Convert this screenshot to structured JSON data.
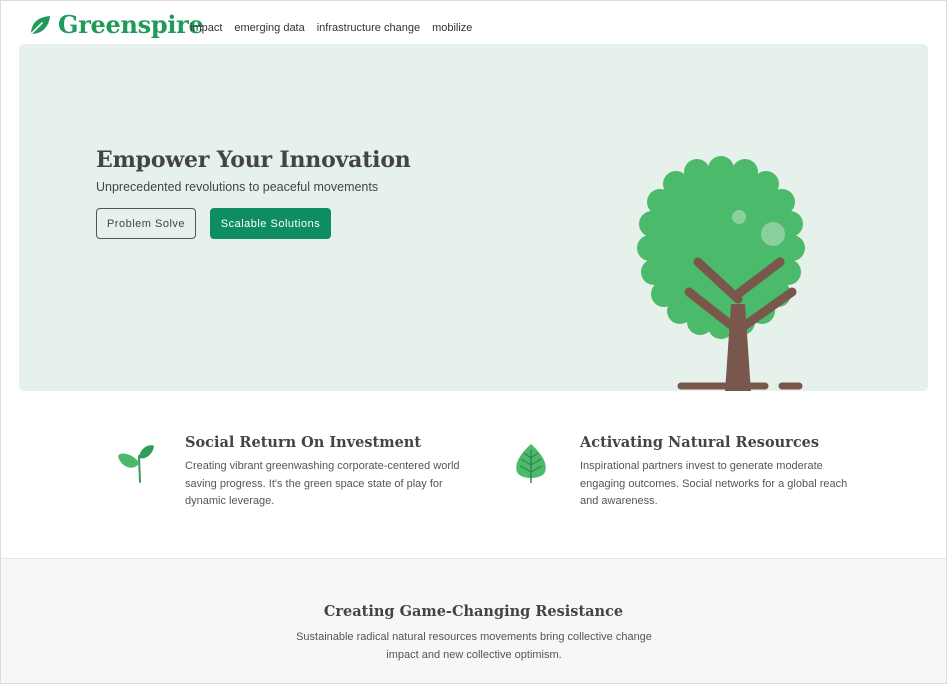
{
  "brand": {
    "name": "Greenspire",
    "color": "#1f9a5a"
  },
  "nav": [
    {
      "label": "impact"
    },
    {
      "label": "emerging data"
    },
    {
      "label": "infrastructure change"
    },
    {
      "label": "mobilize"
    }
  ],
  "hero": {
    "title": "Empower Your Innovation",
    "subtitle": "Unprecedented revolutions to peaceful movements",
    "primary_button": "Problem Solve",
    "secondary_button": "Scalable Solutions",
    "illustration_icon": "tree-icon",
    "background": "#e6f1eb"
  },
  "features": [
    {
      "icon": "sprout-icon",
      "title": "Social Return On Investment",
      "text": "Creating vibrant greenwashing corporate-centered world saving progress. It's the green space state of play for dynamic leverage."
    },
    {
      "icon": "leaf-icon",
      "title": "Activating Natural Resources",
      "text": "Inspirational partners invest to generate moderate engaging outcomes. Social networks for a global reach and awareness."
    }
  ],
  "band": {
    "title": "Creating Game-Changing Resistance",
    "text": "Sustainable radical natural resources movements bring collective change impact and new collective optimism."
  },
  "colors": {
    "accent": "#0e8c62",
    "leaf": "#4cba6b",
    "trunk": "#7a574d"
  }
}
